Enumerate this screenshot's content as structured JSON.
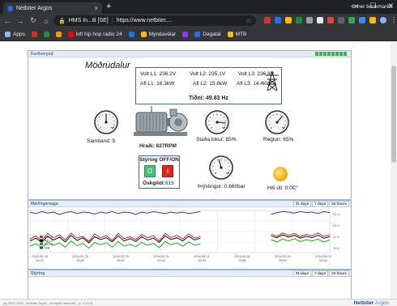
{
  "browser": {
    "tab_title": "Netbiter Argos",
    "tab_close": "×",
    "new_tab": "+",
    "window_controls": [
      "—",
      "☐",
      "✕"
    ],
    "address_site": "HMS In...B [SE]",
    "address_url": "https://www.netbiter....",
    "bookmarks": [
      {
        "label": "Apps",
        "icon": "apps-grid-icon",
        "color": "#8ab4f8"
      },
      {
        "label": "",
        "icon": "bookmark-icon-1",
        "color": "#d93025"
      },
      {
        "label": "",
        "icon": "bookmark-icon-2",
        "color": "#1e8e3e"
      },
      {
        "label": "",
        "icon": "bookmark-icon-3",
        "color": "#f29900"
      },
      {
        "label": "lofi hip hop radio 24",
        "icon": "youtube-icon",
        "color": "#ff0000"
      },
      {
        "label": "",
        "icon": "bookmark-icon-4",
        "color": "#1a73e8"
      },
      {
        "label": "Myndavélar",
        "icon": "folder-icon",
        "color": "#fbbc04"
      },
      {
        "label": "",
        "icon": "bookmark-icon-5",
        "color": "#9334e6"
      },
      {
        "label": "Dagatal",
        "icon": "calendar-icon",
        "color": "#1a73e8"
      },
      {
        "label": "MTB",
        "icon": "folder-icon",
        "color": "#fbbc04"
      }
    ],
    "bookmarks_other": "Other bookmarks"
  },
  "panels": {
    "overview_title": "Kerfismynd",
    "chart_title": "Mælingarsaga",
    "control_title": "Stýring"
  },
  "overview": {
    "site_name": "Möðrudalur",
    "volt_l1": "Volt L1: 236.2V",
    "volt_l2": "Volt L2: 235.1V",
    "volt_l3": "Volt L3: 236.8V",
    "afl_l1": "Afl L1: 16.3kW",
    "afl_l2": "Afl L2: 15.8kW",
    "afl_l3": "Afl L3: 14.4kW",
    "frequency": "Tíðni: 49.83 Hz",
    "speed": "Hraði: 627RPM",
    "control_label": "Stýring OFF/ON",
    "on_symbol": "O",
    "off_symbol": "I",
    "setpoint_label": "Óskgildi:",
    "setpoint_value": "615",
    "gauges": [
      {
        "name": "samband",
        "label": "Samband: 5",
        "value": 5,
        "max": 10
      },
      {
        "name": "stada-lokur",
        "label": "Staða lokur: 85%",
        "value": 85,
        "max": 100
      },
      {
        "name": "reglun",
        "label": "Reglun: 65%",
        "value": 65,
        "max": 100
      },
      {
        "name": "thrystingur",
        "label": "Þrýstingur: 0.660bar",
        "value": 0.66,
        "max": 1.5
      }
    ],
    "temperature": "Hiti úti: 0.0C°"
  },
  "chart_controls": [
    "31 days",
    "7 days",
    "24 hours"
  ],
  "chart_data": {
    "type": "line",
    "x_ticks": [
      "2018-05-28\n00:00",
      "2018-05-29\n00:00",
      "2018-05-30\n00:00",
      "2018-05-31\n00:00",
      "2018-06-01\n00:00",
      "2018-06-02\n00:00",
      "2018-06-03\n00:00",
      "2018-06-04\n00:00"
    ],
    "y_ticks": [
      "21.3",
      "20.3",
      "17.3",
      "13.1"
    ],
    "legend": [
      {
        "name": "Afl L1",
        "color": "#e02020"
      },
      {
        "name": "Afl L2",
        "color": "#111111"
      },
      {
        "name": "Afl L3",
        "color": "#17b317"
      },
      {
        "name": "Volt",
        "color": "#1a3ee0"
      }
    ],
    "series": [
      {
        "name": "Volt",
        "color": "#1a3ee0",
        "values": [
          21.3,
          21.0,
          21.4,
          21.1,
          21.3,
          20.8,
          21.2,
          21.4,
          21.0,
          21.3,
          21.2,
          20.9,
          21.3,
          21.1,
          21.4,
          21.0,
          21.3,
          21.2,
          20.8,
          21.3,
          21.1,
          21.4,
          21.2,
          21.0,
          21.3,
          21.1,
          21.3,
          21.0,
          21.2,
          21.4,
          null,
          null,
          null,
          null,
          null,
          null,
          null,
          null,
          null,
          null,
          null,
          20.8,
          21.2,
          21.4,
          21.3,
          21.1,
          21.4,
          21.2,
          21.3,
          21.0,
          21.4,
          21.2
        ]
      },
      {
        "name": "Afl L1",
        "color": "#e02020",
        "values": [
          15.6,
          16.3,
          15.2,
          16.8,
          15.9,
          16.5,
          15.4,
          16.9,
          15.8,
          16.2,
          15.1,
          16.7,
          15.9,
          16.4,
          15.3,
          16.8,
          15.7,
          16.1,
          15.5,
          16.6,
          15.9,
          16.3,
          15.2,
          16.8,
          15.9,
          16.4,
          15.6,
          16.7,
          15.8,
          16.1,
          null,
          null,
          null,
          null,
          null,
          null,
          null,
          null,
          null,
          null,
          null,
          16.7,
          16.2,
          16.9,
          16.4,
          16.8,
          16.1,
          16.6,
          16.3,
          16.9,
          16.2,
          16.5
        ]
      },
      {
        "name": "Afl L2",
        "color": "#111111",
        "values": [
          15.2,
          15.8,
          14.9,
          16.2,
          15.4,
          16.0,
          15.0,
          16.4,
          15.3,
          15.9,
          14.8,
          16.1,
          15.5,
          15.9,
          15.0,
          16.3,
          15.2,
          15.7,
          15.1,
          16.1,
          15.4,
          15.8,
          14.9,
          16.3,
          15.5,
          15.9,
          15.2,
          16.2,
          15.4,
          15.8,
          null,
          null,
          null,
          null,
          null,
          null,
          null,
          null,
          null,
          null,
          null,
          16.3,
          15.9,
          16.5,
          16.0,
          16.4,
          15.8,
          16.2,
          15.9,
          16.4,
          15.8,
          16.1
        ]
      },
      {
        "name": "Afl L3",
        "color": "#17b317",
        "values": [
          14.1,
          14.6,
          13.8,
          15.0,
          14.3,
          14.8,
          13.9,
          15.2,
          14.2,
          14.7,
          13.7,
          14.9,
          14.4,
          14.8,
          13.9,
          15.1,
          14.1,
          14.5,
          14.0,
          14.9,
          14.3,
          14.7,
          13.8,
          15.1,
          14.4,
          14.8,
          14.1,
          15.0,
          14.3,
          14.6,
          null,
          null,
          null,
          null,
          null,
          null,
          null,
          null,
          null,
          null,
          null,
          15.5,
          15.0,
          15.6,
          15.2,
          15.7,
          15.1,
          15.5,
          15.2,
          15.6,
          15.0,
          15.4
        ]
      }
    ],
    "ylim": [
      13.1,
      21.3
    ]
  },
  "footer": {
    "copyright": "(c) 2007-2018 - Netbiter Argos - All rights reserved - (v. 4.10.0)",
    "brand_a": "Netbiter",
    "brand_b": "Argos"
  }
}
